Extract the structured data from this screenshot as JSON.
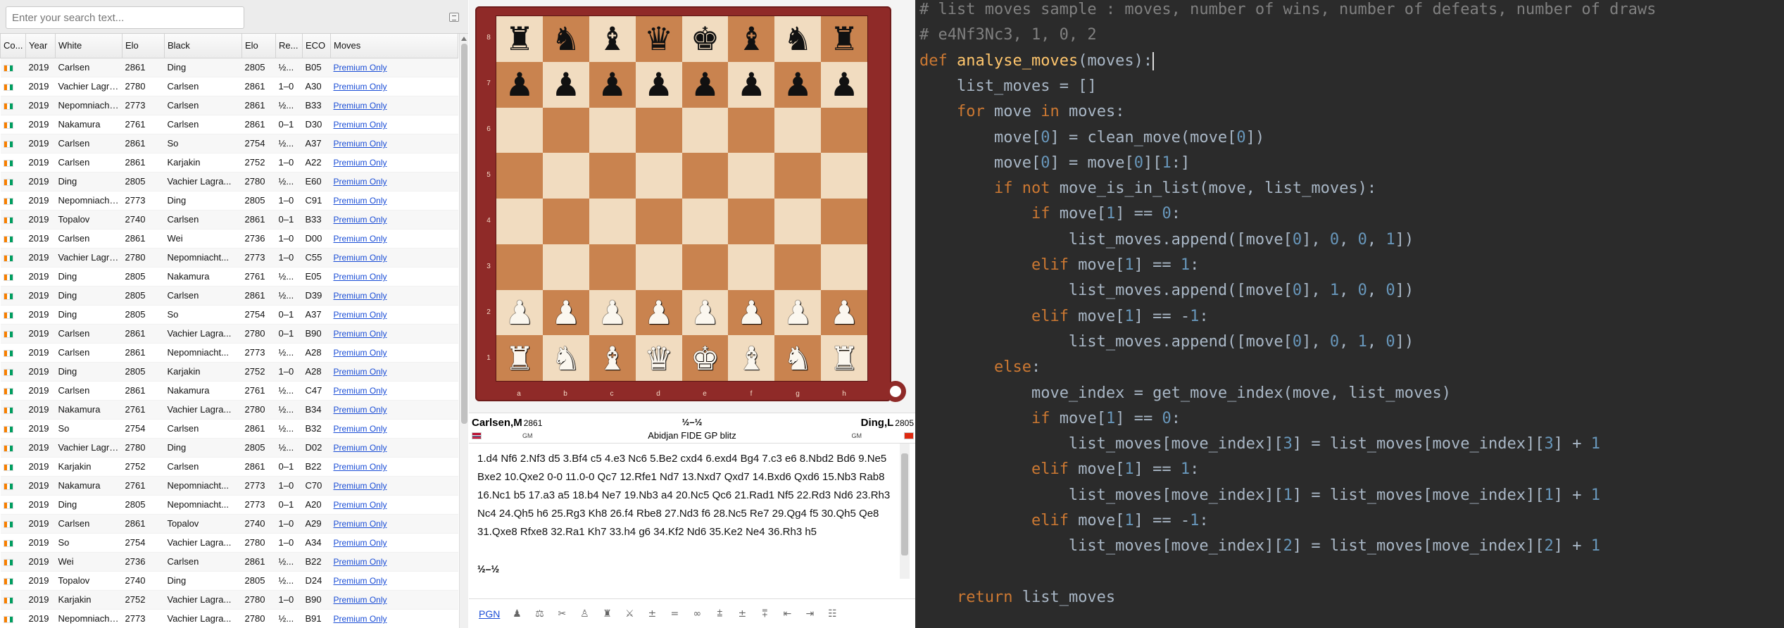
{
  "search": {
    "placeholder": "Enter your search text..."
  },
  "table": {
    "columns": [
      "Co...",
      "Year",
      "White",
      "Elo",
      "Black",
      "Elo",
      "Re...",
      "ECO",
      "Moves"
    ],
    "premium_label": "Premium Only",
    "rows": [
      [
        "2019",
        "Carlsen",
        "2861",
        "Ding",
        "2805",
        "½...",
        "B05"
      ],
      [
        "2019",
        "Vachier Lagra...",
        "2780",
        "Carlsen",
        "2861",
        "1–0",
        "A30"
      ],
      [
        "2019",
        "Nepomniacht...",
        "2773",
        "Carlsen",
        "2861",
        "½...",
        "B33"
      ],
      [
        "2019",
        "Nakamura",
        "2761",
        "Carlsen",
        "2861",
        "0–1",
        "D30"
      ],
      [
        "2019",
        "Carlsen",
        "2861",
        "So",
        "2754",
        "½...",
        "A37"
      ],
      [
        "2019",
        "Carlsen",
        "2861",
        "Karjakin",
        "2752",
        "1–0",
        "A22"
      ],
      [
        "2019",
        "Ding",
        "2805",
        "Vachier Lagra...",
        "2780",
        "½...",
        "E60"
      ],
      [
        "2019",
        "Nepomniacht...",
        "2773",
        "Ding",
        "2805",
        "1–0",
        "C91"
      ],
      [
        "2019",
        "Topalov",
        "2740",
        "Carlsen",
        "2861",
        "0–1",
        "B33"
      ],
      [
        "2019",
        "Carlsen",
        "2861",
        "Wei",
        "2736",
        "1–0",
        "D00"
      ],
      [
        "2019",
        "Vachier Lagra...",
        "2780",
        "Nepomniacht...",
        "2773",
        "1–0",
        "C55"
      ],
      [
        "2019",
        "Ding",
        "2805",
        "Nakamura",
        "2761",
        "½...",
        "E05"
      ],
      [
        "2019",
        "Ding",
        "2805",
        "Carlsen",
        "2861",
        "½...",
        "D39"
      ],
      [
        "2019",
        "Ding",
        "2805",
        "So",
        "2754",
        "0–1",
        "A37"
      ],
      [
        "2019",
        "Carlsen",
        "2861",
        "Vachier Lagra...",
        "2780",
        "0–1",
        "B90"
      ],
      [
        "2019",
        "Carlsen",
        "2861",
        "Nepomniacht...",
        "2773",
        "½...",
        "A28"
      ],
      [
        "2019",
        "Ding",
        "2805",
        "Karjakin",
        "2752",
        "1–0",
        "A28"
      ],
      [
        "2019",
        "Carlsen",
        "2861",
        "Nakamura",
        "2761",
        "½...",
        "C47"
      ],
      [
        "2019",
        "Nakamura",
        "2761",
        "Vachier Lagra...",
        "2780",
        "½...",
        "B34"
      ],
      [
        "2019",
        "So",
        "2754",
        "Carlsen",
        "2861",
        "½...",
        "B32"
      ],
      [
        "2019",
        "Vachier Lagra...",
        "2780",
        "Ding",
        "2805",
        "½...",
        "D02"
      ],
      [
        "2019",
        "Karjakin",
        "2752",
        "Carlsen",
        "2861",
        "0–1",
        "B22"
      ],
      [
        "2019",
        "Nakamura",
        "2761",
        "Nepomniacht...",
        "2773",
        "1–0",
        "C70"
      ],
      [
        "2019",
        "Ding",
        "2805",
        "Nepomniacht...",
        "2773",
        "0–1",
        "A20"
      ],
      [
        "2019",
        "Carlsen",
        "2861",
        "Topalov",
        "2740",
        "1–0",
        "A29"
      ],
      [
        "2019",
        "So",
        "2754",
        "Vachier Lagra...",
        "2780",
        "1–0",
        "A34"
      ],
      [
        "2019",
        "Wei",
        "2736",
        "Carlsen",
        "2861",
        "½...",
        "B22"
      ],
      [
        "2019",
        "Topalov",
        "2740",
        "Ding",
        "2805",
        "½...",
        "D24"
      ],
      [
        "2019",
        "Karjakin",
        "2752",
        "Vachier Lagra...",
        "2780",
        "1–0",
        "B90"
      ],
      [
        "2019",
        "Nepomniacht...",
        "2773",
        "Vachier Lagra...",
        "2780",
        "½...",
        "B91"
      ]
    ]
  },
  "board": {
    "ranks": [
      "8",
      "7",
      "6",
      "5",
      "4",
      "3",
      "2",
      "1"
    ],
    "files": [
      "a",
      "b",
      "c",
      "d",
      "e",
      "f",
      "g",
      "h"
    ],
    "position": [
      [
        "br",
        "bn",
        "bb",
        "bq",
        "bk",
        "bb",
        "bn",
        "br"
      ],
      [
        "bp",
        "bp",
        "bp",
        "bp",
        "bp",
        "bp",
        "bp",
        "bp"
      ],
      [
        "",
        "",
        "",
        "",
        "",
        "",
        "",
        ""
      ],
      [
        "",
        "",
        "",
        "",
        "",
        "",
        "",
        ""
      ],
      [
        "",
        "",
        "",
        "",
        "",
        "",
        "",
        ""
      ],
      [
        "",
        "",
        "",
        "",
        "",
        "",
        "",
        ""
      ],
      [
        "wp",
        "wp",
        "wp",
        "wp",
        "wp",
        "wp",
        "wp",
        "wp"
      ],
      [
        "wr",
        "wn",
        "wb",
        "wq",
        "wk",
        "wb",
        "wn",
        "wr"
      ]
    ],
    "colors": {
      "light": "#f1dcc0",
      "dark": "#c9834f",
      "frame": "#8f2a28"
    }
  },
  "game": {
    "white_name": "Carlsen,M",
    "white_elo": "2861",
    "white_title": "GM",
    "black_name": "Ding,L",
    "black_elo": "2805",
    "black_title": "GM",
    "result": "½–½",
    "event": "Abidjan FIDE GP blitz",
    "moves": "1.d4 Nf6 2.Nf3 d5 3.Bf4 c5 4.e3 Nc6 5.Be2 cxd4 6.exd4 Bg4 7.c3 e6 8.Nbd2 Bd6 9.Ne5 Bxe2 10.Qxe2 0-0 11.0-0 Qc7 12.Rfe1 Nd7 13.Nxd7 Qxd7 14.Bxd6 Qxd6 15.Nb3 Rab8 16.Nc1 b5 17.a3 a5 18.b4 Ne7 19.Nb3 a4 20.Nc5 Qc6 21.Rad1 Nf5 22.Rd3 Nd6 23.Rh3 Nc4 24.Qh5 h6 25.Rg3 Kh8 26.f4 Rbe8 27.Nd3 f6 28.Nc5 Re7 29.Qg4 f5 30.Qh5 Qe8 31.Qxe8 Rfxe8 32.Ra1 Kh7 33.h4 g6 34.Kf2 Nd6 35.Ke2 Ne4 36.Rh3 h5",
    "final_result": "½–½"
  },
  "toolbar": {
    "pgn_label": "PGN"
  },
  "editor": {
    "colors": {
      "background": "#2b2b2b",
      "comment": "#808080",
      "keyword": "#cc7832",
      "function": "#ffc66d",
      "number": "#6897bb",
      "text": "#a9b7c6"
    },
    "lines": [
      "# list moves sample : moves, number of wins, number of defeats, number of draws",
      "# e4Nf3Nc3, 1, 0, 2",
      "def analyse_moves(moves):",
      "    list_moves = []",
      "    for move in moves:",
      "        move[0] = clean_move(move[0])",
      "        move[0] = move[0][1:]",
      "        if not move_is_in_list(move, list_moves):",
      "            if move[1] == 0:",
      "                list_moves.append([move[0], 0, 0, 1])",
      "            elif move[1] == 1:",
      "                list_moves.append([move[0], 1, 0, 0])",
      "            elif move[1] == -1:",
      "                list_moves.append([move[0], 0, 1, 0])",
      "        else:",
      "            move_index = get_move_index(move, list_moves)",
      "            if move[1] == 0:",
      "                list_moves[move_index][3] = list_moves[move_index][3] + 1",
      "            elif move[1] == 1:",
      "                list_moves[move_index][1] = list_moves[move_index][1] + 1",
      "            elif move[1] == -1:",
      "                list_moves[move_index][2] = list_moves[move_index][2] + 1",
      "",
      "    return list_moves"
    ]
  }
}
